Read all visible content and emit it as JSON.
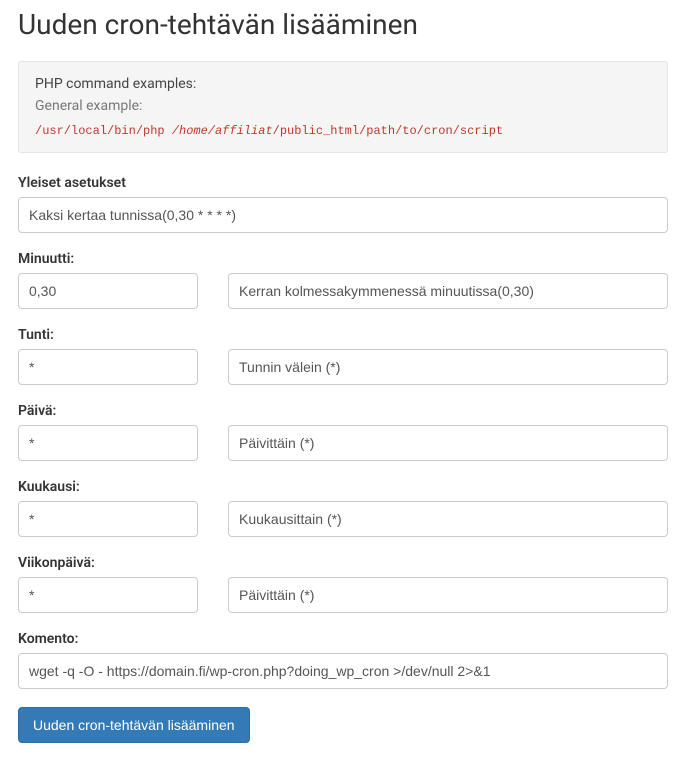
{
  "title": "Uuden cron-tehtävän lisääminen",
  "info": {
    "line1": "PHP command examples:",
    "line2": "General example:",
    "code_part1": "/usr/local/bin/php ",
    "code_part2": "/home/affiliat",
    "code_part3": "/public_html/path/to/cron/script"
  },
  "general": {
    "label": "Yleiset asetukset",
    "selected": "Kaksi kertaa tunnissa(0,30 * * * *)"
  },
  "minute": {
    "label": "Minuutti:",
    "value": "0,30",
    "selected": "Kerran kolmessakymmenessä minuutissa(0,30)"
  },
  "hour": {
    "label": "Tunti:",
    "value": "*",
    "selected": "Tunnin välein (*)"
  },
  "day": {
    "label": "Päivä:",
    "value": "*",
    "selected": "Päivittäin (*)"
  },
  "month": {
    "label": "Kuukausi:",
    "value": "*",
    "selected": "Kuukausittain (*)"
  },
  "weekday": {
    "label": "Viikonpäivä:",
    "value": "*",
    "selected": "Päivittäin (*)"
  },
  "command": {
    "label": "Komento:",
    "value": "wget -q -O - https://domain.fi/wp-cron.php?doing_wp_cron >/dev/null 2>&1"
  },
  "submit": {
    "label": "Uuden cron-tehtävän lisääminen"
  }
}
